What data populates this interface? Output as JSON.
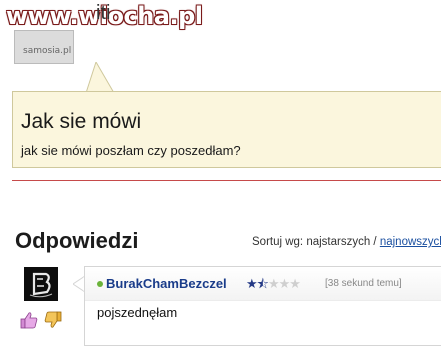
{
  "watermark": {
    "text": "www.wiocha.pl"
  },
  "top_partial": {
    "name_fragment": "iti",
    "avatar_brand": "samosia.pl"
  },
  "question": {
    "title": "Jak sie mówi",
    "text": "jak sie mówi poszłam czy poszedłam?"
  },
  "answers": {
    "heading": "Odpowiedzi",
    "sort_label": "Sortuj wg: najstarszych / ",
    "sort_link": "najnowszych"
  },
  "comment": {
    "author": "BurakChamBezczel",
    "time": "[38 sekund temu]",
    "body": "pojszednęłam",
    "rating": 1.5,
    "rating_max": 5
  },
  "colors": {
    "question_bg": "#fbf6dd",
    "divider": "#c64a4a",
    "link": "#1a4fa0",
    "author": "#1a3c8a",
    "online": "#6bb33a"
  },
  "icons": [
    "thumbs-up-icon",
    "thumbs-down-icon",
    "star-icon",
    "online-dot-icon"
  ]
}
